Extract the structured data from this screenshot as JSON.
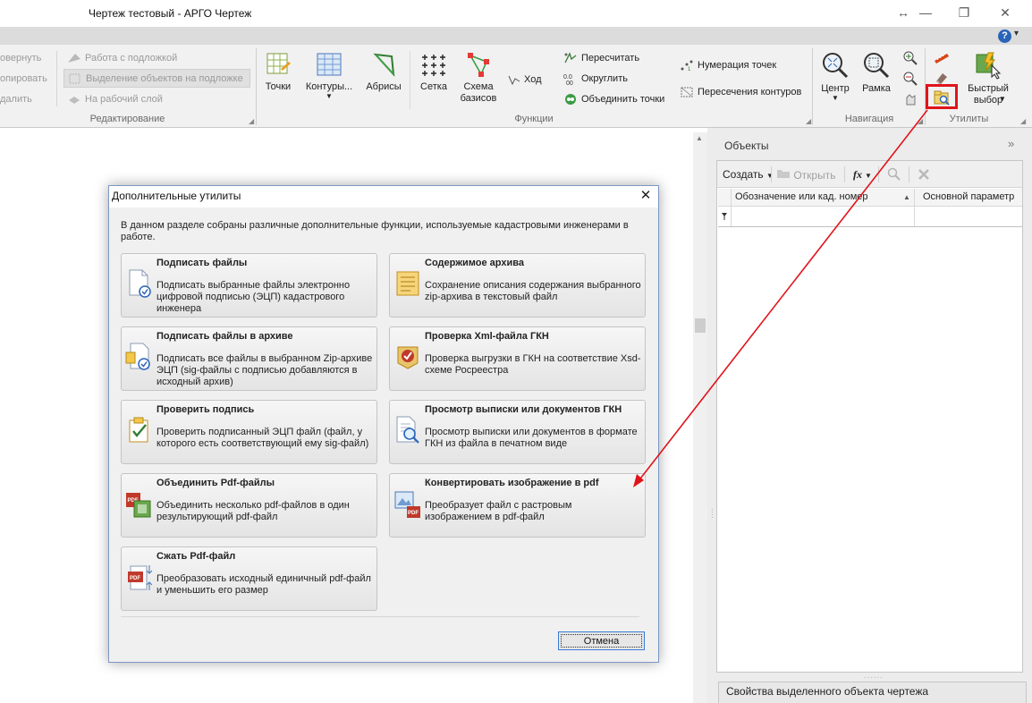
{
  "window": {
    "title": "Чертеж тестовый - АРГО Чертеж",
    "controls": [
      "↔",
      "—",
      "❐",
      "✕"
    ]
  },
  "help": {
    "label": "?"
  },
  "ribbon": {
    "edit_group": {
      "title": "Редактирование",
      "items": [
        "овернуть",
        "опировать",
        "далить"
      ],
      "underlay_items": [
        "Работа с подложкой",
        "Выделение объектов на подложке",
        "На рабочий слой"
      ]
    },
    "functions_group": {
      "title": "Функции",
      "big_buttons": [
        {
          "label": "Точки"
        },
        {
          "label": "Контуры..."
        },
        {
          "label": "Абрисы"
        },
        {
          "label": "Сетка"
        },
        {
          "label": "Схема\nбазисов"
        }
      ],
      "small_items": [
        "Ход",
        "Пересчитать",
        "Округлить",
        "Объединить точки",
        "Нумерация точек",
        "Пересечения контуров"
      ]
    },
    "navigation_group": {
      "title": "Навигация",
      "big_buttons": [
        {
          "label": "Центр"
        },
        {
          "label": "Рамка"
        }
      ]
    },
    "utilities_group": {
      "title": "Утилиты",
      "big_buttons": [
        {
          "label": "Быстрый\nвыбор"
        }
      ]
    }
  },
  "objects_panel": {
    "title": "Объекты",
    "toolbar": {
      "create": "Создать",
      "open": "Открыть",
      "fx": "fx"
    },
    "columns": [
      "Обозначение или кад. номер",
      "Основной параметр"
    ],
    "properties_title": "Свойства выделенного объекта чертежа"
  },
  "dialog": {
    "title": "Дополнительные утилиты",
    "description": "В данном разделе собраны различные дополнительные функции, используемые кадастровыми инженерами в работе.",
    "cards": [
      {
        "title": "Подписать файлы",
        "desc": "Подписать выбранные файлы электронно цифровой подписью (ЭЦП) кадастрового инженера",
        "icon": "sign-file-icon"
      },
      {
        "title": "Содержимое архива",
        "desc": "Сохранение описания содержания выбранного zip-архива в текстовый файл",
        "icon": "archive-contents-icon"
      },
      {
        "title": "Подписать файлы в архиве",
        "desc": "Подписать все файлы в выбранном Zip-архиве ЭЦП (sig-файлы с подписью добавляются в исходный архив)",
        "icon": "sign-archive-icon"
      },
      {
        "title": "Проверка Xml-файла ГКН",
        "desc": "Проверка выгрузки в ГКН на соответствие Xsd-схеме Росреестра",
        "icon": "xml-check-icon"
      },
      {
        "title": "Проверить подпись",
        "desc": "Проверить подписанный ЭЦП файл (файл, у которого есть соответствующий ему sig-файл)",
        "icon": "verify-signature-icon"
      },
      {
        "title": "Просмотр выписки или документов ГКН",
        "desc": "Просмотр выписки или документов в формате ГКН из файла в печатном виде",
        "icon": "view-document-icon"
      },
      {
        "title": "Объединить Pdf-файлы",
        "desc": "Объединить несколько pdf-файлов в один результирующий pdf-файл",
        "icon": "merge-pdf-icon"
      },
      {
        "title": "Конвертировать изображение в pdf",
        "desc": "Преобразует файл с растровым изображением в pdf-файл",
        "icon": "image-to-pdf-icon"
      },
      {
        "title": "Сжать Pdf-файл",
        "desc": "Преобразовать исходный единичный pdf-файл и уменьшить его размер",
        "icon": "compress-pdf-icon"
      }
    ],
    "cancel_label": "Отмена"
  },
  "colors": {
    "annotation": "#e0141b",
    "ribbon_bg": "#f1f1f1",
    "dialog_border": "#7c98c2"
  }
}
